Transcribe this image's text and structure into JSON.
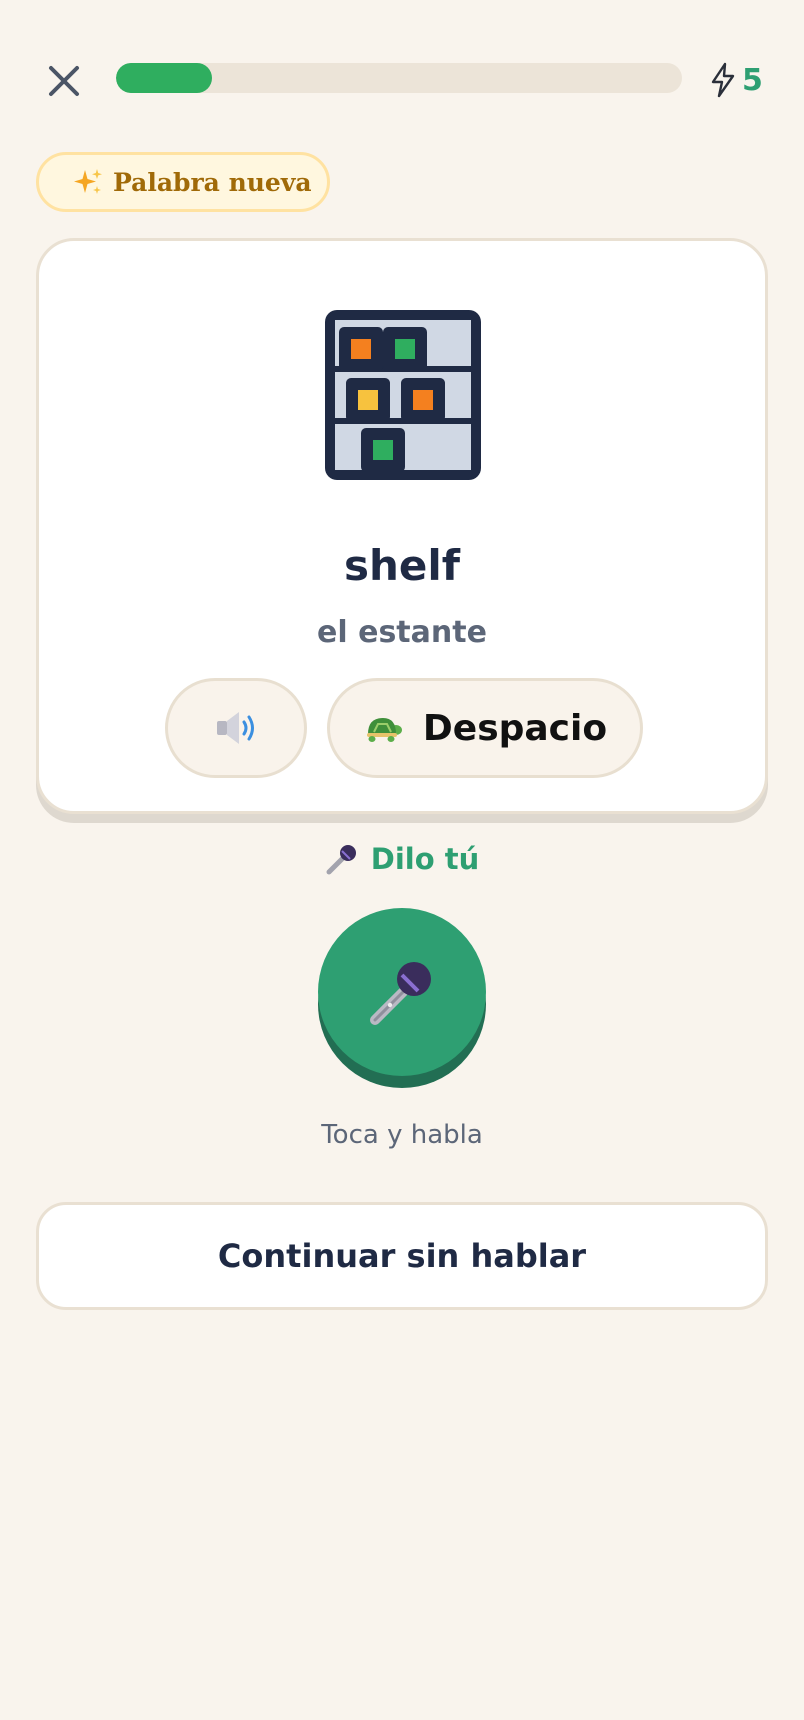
{
  "header": {
    "close_icon": "close-icon",
    "progress": 0.17,
    "energy_icon": "lightning-icon",
    "energy_count": "5"
  },
  "badge": {
    "icon": "sparkles-icon",
    "label": "Palabra nueva"
  },
  "card": {
    "image_icon": "shelf-icon",
    "word": "shelf",
    "translation": "el estante",
    "audio_icon": "speaker-icon",
    "slow_icon": "turtle-icon",
    "slow_label": "Despacio"
  },
  "speak": {
    "heading_icon": "microphone-icon",
    "heading": "Dilo tú",
    "hint": "Toca y habla"
  },
  "footer": {
    "continue_label": "Continuar sin hablar"
  },
  "colors": {
    "background": "#f9f4ed",
    "accent_green": "#2e9f72",
    "progress_green": "#2fae5f",
    "badge_text": "#a06a08",
    "navy": "#1f2a44"
  }
}
